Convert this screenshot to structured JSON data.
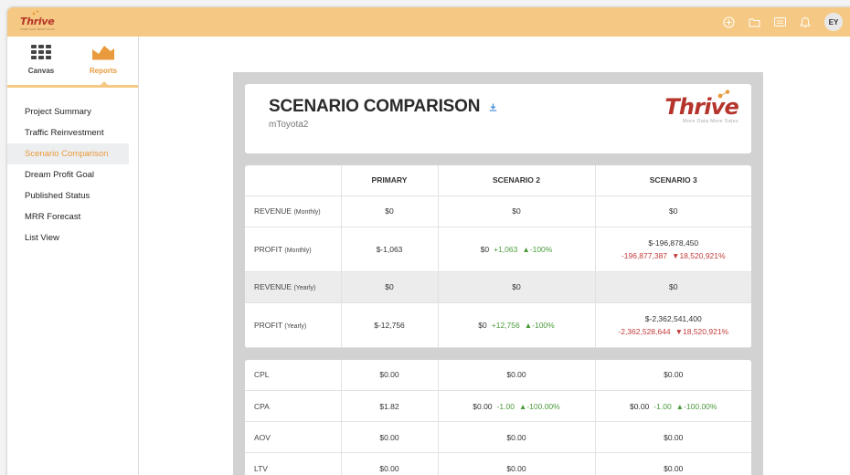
{
  "topbar": {
    "logo": "Thrive",
    "logo_sub": "MORE DATA MORE SALES",
    "avatar": "EY"
  },
  "sidebar": {
    "modes": [
      {
        "label": "Canvas",
        "icon": "grid-icon"
      },
      {
        "label": "Reports",
        "icon": "chart-area-icon"
      }
    ],
    "items": [
      {
        "label": "Project Summary"
      },
      {
        "label": "Traffic Reinvestment"
      },
      {
        "label": "Scenario Comparison"
      },
      {
        "label": "Dream Profit Goal"
      },
      {
        "label": "Published Status"
      },
      {
        "label": "MRR Forecast"
      },
      {
        "label": "List View"
      }
    ]
  },
  "report": {
    "title": "SCENARIO COMPARISON",
    "subtitle": "mToyota2",
    "brand": "Thrive",
    "brand_tag": "More Data More Sales",
    "columns": [
      "",
      "PRIMARY",
      "SCENARIO 2",
      "SCENARIO 3"
    ],
    "rows": [
      {
        "label": "REVENUE",
        "unit": "(Monthly)",
        "primary": "$0",
        "s2": "$0",
        "s3": "$0"
      },
      {
        "label": "PROFIT",
        "unit": "(Monthly)",
        "primary": "$-1,063",
        "s2": "$0",
        "s2_delta": "+1,063",
        "s2_pct": "▲-100%",
        "s3": "$-196,878,450",
        "s3_delta": "-196,877,387",
        "s3_pct": "▼18,520,921%"
      },
      {
        "label": "REVENUE",
        "unit": "(Yearly)",
        "primary": "$0",
        "s2": "$0",
        "s3": "$0"
      },
      {
        "label": "PROFIT",
        "unit": "(Yearly)",
        "primary": "$-12,756",
        "s2": "$0",
        "s2_delta": "+12,756",
        "s2_pct": "▲-100%",
        "s3": "$-2,362,541,400",
        "s3_delta": "-2,362,528,644",
        "s3_pct": "▼18,520,921%"
      }
    ],
    "metrics": [
      {
        "label": "CPL",
        "primary": "$0.00",
        "s2": "$0.00",
        "s3": "$0.00"
      },
      {
        "label": "CPA",
        "primary": "$1.82",
        "s2": "$0.00",
        "s2_delta": "-1.00",
        "s2_pct": "▲-100.00%",
        "s3": "$0.00",
        "s3_delta": "-1.00",
        "s3_pct": "▲-100.00%"
      },
      {
        "label": "AOV",
        "primary": "$0.00",
        "s2": "$0.00",
        "s3": "$0.00"
      },
      {
        "label": "LTV",
        "primary": "$0.00",
        "s2": "$0.00",
        "s3": "$0.00"
      }
    ]
  },
  "colors": {
    "topbar": "#f5c984",
    "accent": "#e89a3c",
    "brand": "#b5342b",
    "positive": "#4a9a3a",
    "negative": "#c43b3b"
  }
}
